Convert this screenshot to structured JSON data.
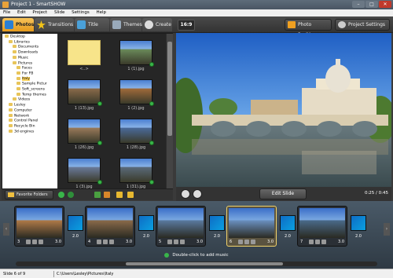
{
  "window": {
    "title": "Project 1 - SmartSHOW",
    "minimize": "–",
    "maximize": "□",
    "close": "✕"
  },
  "menu": [
    "File",
    "Edit",
    "Project",
    "Slide",
    "Settings",
    "Help"
  ],
  "tabs": [
    "Photos",
    "Transitions",
    "Title Clips",
    "Themes",
    "Create"
  ],
  "aspect_ratio": "16:9",
  "photo_position_label": "Photo Position",
  "project_settings_label": "Project Settings",
  "tree": [
    {
      "label": "Desktop",
      "indent": 0
    },
    {
      "label": "Libraries",
      "indent": 1
    },
    {
      "label": "Documents",
      "indent": 2
    },
    {
      "label": "Downloads",
      "indent": 2
    },
    {
      "label": "Music",
      "indent": 2
    },
    {
      "label": "Pictures",
      "indent": 2
    },
    {
      "label": "Faces",
      "indent": 3
    },
    {
      "label": "For FB",
      "indent": 3
    },
    {
      "label": "Italy",
      "indent": 3,
      "selected": true
    },
    {
      "label": "Sample Pictur",
      "indent": 3
    },
    {
      "label": "Soft_screens",
      "indent": 3
    },
    {
      "label": "Temp themes",
      "indent": 3
    },
    {
      "label": "Videos",
      "indent": 2
    },
    {
      "label": "Lesley",
      "indent": 1
    },
    {
      "label": "Computer",
      "indent": 1
    },
    {
      "label": "Network",
      "indent": 1
    },
    {
      "label": "Control Panel",
      "indent": 1
    },
    {
      "label": "Recycle Bin",
      "indent": 1
    },
    {
      "label": "3d engines",
      "indent": 1
    }
  ],
  "thumbnails": [
    {
      "label": "<..>",
      "color": "folder"
    },
    {
      "label": "1 (1).jpg",
      "color": "#6a8a5a"
    },
    {
      "label": "1 (13).jpg",
      "color": "#8a6a4a"
    },
    {
      "label": "1 (2).jpg",
      "color": "#a06a3a"
    },
    {
      "label": "1 (26).jpg",
      "color": "#9a7a5a"
    },
    {
      "label": "1 (28).jpg",
      "color": "#4a6a9a"
    },
    {
      "label": "1 (3).jpg",
      "color": "#6a7a9a"
    },
    {
      "label": "1 (31).jpg",
      "color": "#5a6a7a"
    }
  ],
  "favorite_folders_label": "Favorite Folders",
  "edit_slide_label": "Edit Slide",
  "timecode": "0:25 / 0:45",
  "slides": [
    {
      "num": "3",
      "duration": "3.0"
    },
    {
      "num": "4",
      "duration": "3.0"
    },
    {
      "num": "5",
      "duration": "3.0"
    },
    {
      "num": "6",
      "duration": "3.0",
      "selected": true
    },
    {
      "num": "7",
      "duration": "3.0"
    }
  ],
  "transition_durations": [
    "2.0",
    "2.0",
    "2.0",
    "2.0",
    "2.0"
  ],
  "music_hint": "Double-click to add music",
  "status": {
    "slide": "Slide 6 of 9",
    "path": "C:\\Users\\Lesley\\Pictures\\Italy"
  }
}
